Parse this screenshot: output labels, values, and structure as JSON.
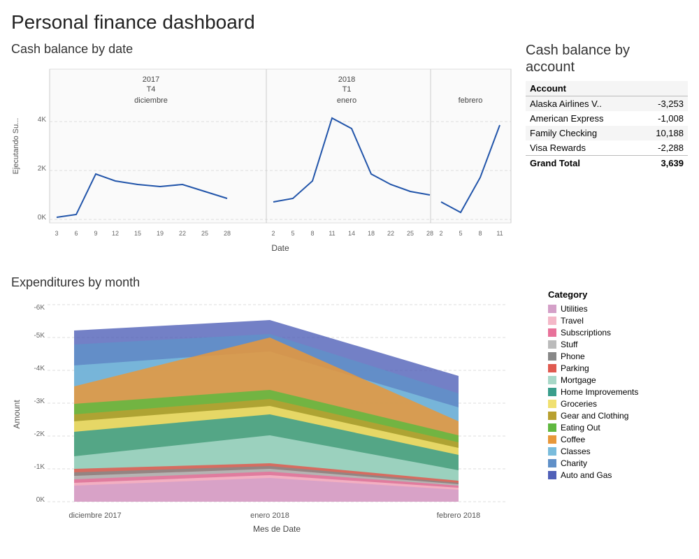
{
  "title": "Personal finance dashboard",
  "cashBalanceByDate": {
    "title": "Cash balance by date",
    "yAxisLabel": "Ejecutando Su...",
    "xAxisLabel": "Date",
    "sections": [
      {
        "year": "2017",
        "quarter": "T4",
        "month": "diciembre",
        "ticks": [
          "3",
          "6",
          "9",
          "12",
          "15",
          "19",
          "22",
          "25",
          "28"
        ]
      },
      {
        "year": "2018",
        "quarter": "T1",
        "month": "enero",
        "ticks": [
          "2",
          "5",
          "8",
          "11",
          "14",
          "18",
          "22",
          "25",
          "28"
        ]
      },
      {
        "month": "febrero",
        "ticks": [
          "2",
          "5",
          "8",
          "11"
        ]
      }
    ]
  },
  "cashBalanceByAccount": {
    "title": "Cash balance by\naccount",
    "columns": [
      "Account",
      ""
    ],
    "rows": [
      {
        "account": "Alaska Airlines V..",
        "value": "-3,253"
      },
      {
        "account": "American Express",
        "value": "-1,008"
      },
      {
        "account": "Family Checking",
        "value": "10,188"
      },
      {
        "account": "Visa Rewards",
        "value": "-2,288"
      }
    ],
    "total": {
      "label": "Grand Total",
      "value": "3,639"
    }
  },
  "expendituresByMonth": {
    "title": "Expenditures by month",
    "yAxisLabel": "Amount",
    "xAxisLabel": "Mes de Date",
    "months": [
      "diciembre 2017",
      "enero 2018",
      "febrero 2018"
    ],
    "yTicks": [
      "0K",
      "-1K",
      "-2K",
      "-3K",
      "-4K",
      "-5K",
      "-6K"
    ]
  },
  "legend": {
    "title": "Category",
    "items": [
      {
        "label": "Utilities",
        "color": "#d4a0c8"
      },
      {
        "label": "Travel",
        "color": "#f4b8c8"
      },
      {
        "label": "Subscriptions",
        "color": "#e8729a"
      },
      {
        "label": "Stuff",
        "color": "#bbb"
      },
      {
        "label": "Phone",
        "color": "#888"
      },
      {
        "label": "Parking",
        "color": "#e05a50"
      },
      {
        "label": "Mortgage",
        "color": "#a8d8c8"
      },
      {
        "label": "Home Improvements",
        "color": "#3a9e8c"
      },
      {
        "label": "Groceries",
        "color": "#f0e070"
      },
      {
        "label": "Gear and Clothing",
        "color": "#b8a030"
      },
      {
        "label": "Eating Out",
        "color": "#60b840"
      },
      {
        "label": "Coffee",
        "color": "#e8983a"
      },
      {
        "label": "Classes",
        "color": "#7abcdc"
      },
      {
        "label": "Charity",
        "color": "#6090c8"
      },
      {
        "label": "Auto and Gas",
        "color": "#5060b8"
      }
    ]
  }
}
